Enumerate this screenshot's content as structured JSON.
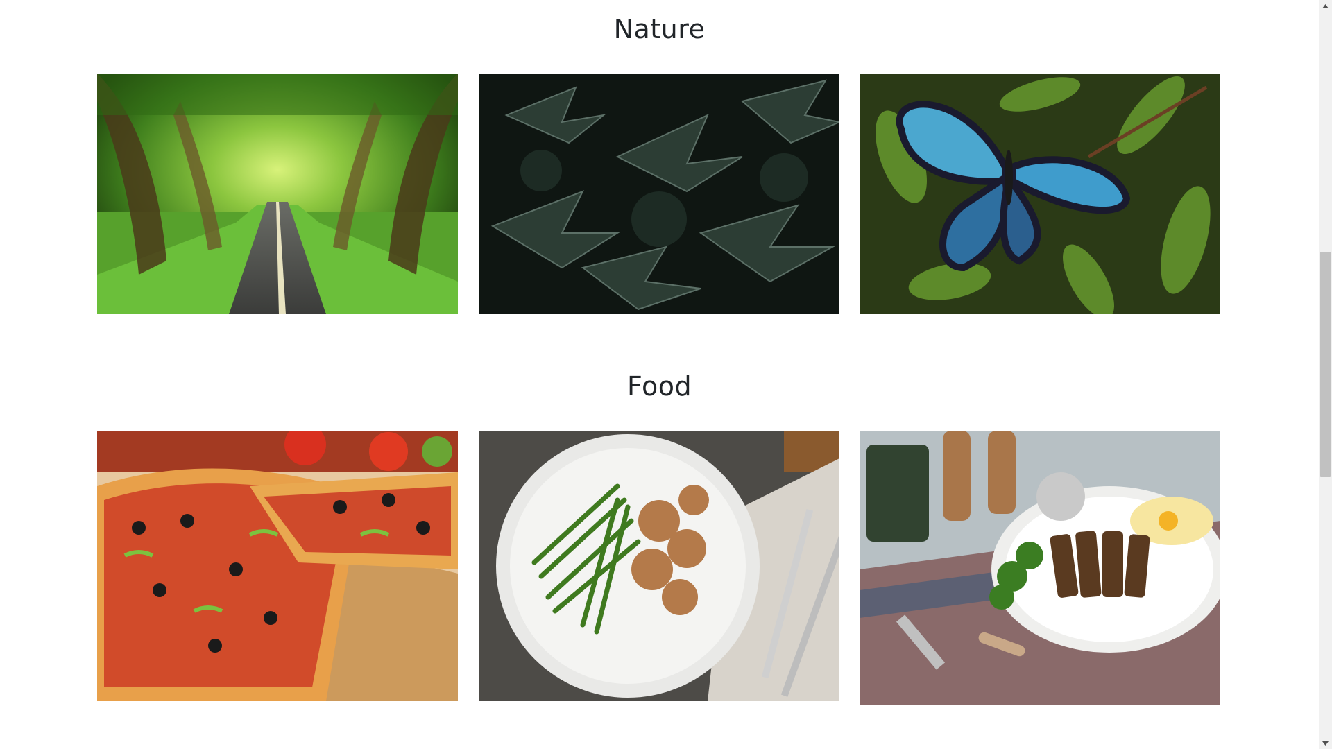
{
  "sections": [
    {
      "title": "Nature",
      "photos": [
        {
          "icon": "tree-lined-road-photo"
        },
        {
          "icon": "dark-leaves-photo"
        },
        {
          "icon": "blue-butterfly-photo"
        }
      ]
    },
    {
      "title": "Food",
      "photos": [
        {
          "icon": "pizza-photo"
        },
        {
          "icon": "green-beans-chicken-plate-photo"
        },
        {
          "icon": "grilled-steak-rice-plate-photo"
        }
      ]
    }
  ],
  "scrollbar": {
    "position_percent": 31
  }
}
